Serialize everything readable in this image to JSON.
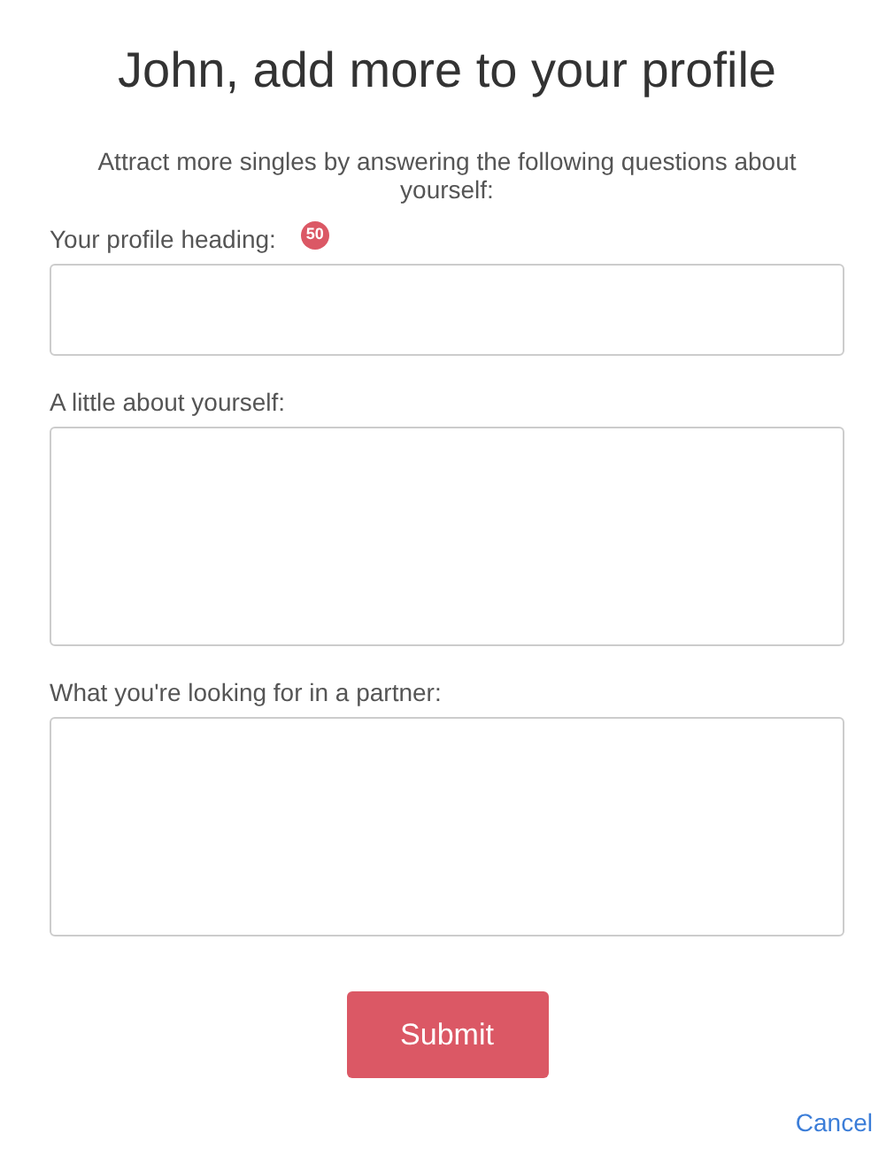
{
  "title": "John, add more to your profile",
  "intro": "Attract more singles by answering the following questions about yourself:",
  "fields": [
    {
      "kind": "input",
      "label": "Your profile heading:",
      "counter": "50"
    },
    {
      "kind": "textarea",
      "label": "A little about yourself:"
    },
    {
      "kind": "textarea",
      "label": "What you're looking for in a partner:"
    }
  ],
  "submit": "Submit",
  "cancel": "Cancel"
}
